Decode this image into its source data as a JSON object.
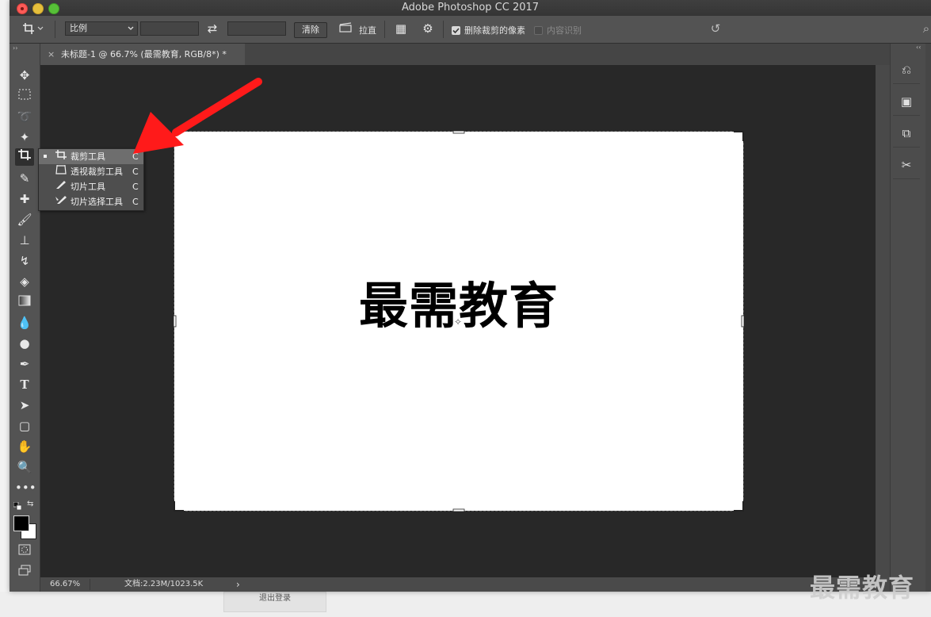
{
  "window": {
    "title": "Adobe Photoshop CC 2017"
  },
  "options_bar": {
    "tool_glyph": "⌗",
    "ratio_select": "比例",
    "width_value": "",
    "height_value": "",
    "clear_button": "清除",
    "straighten_label": "拉直",
    "delete_cropped_label": "删除裁剪的像素",
    "delete_cropped_checked": true,
    "content_aware_label": "内容识别",
    "content_aware_checked": false
  },
  "document_tab": {
    "title": "未标题-1 @ 66.7% (最需教育, RGB/8*) *",
    "close": "×"
  },
  "canvas": {
    "text": "最需教育"
  },
  "tool_flyout": {
    "items": [
      {
        "label": "裁剪工具",
        "shortcut": "C",
        "icon": "crop-icon",
        "selected": true
      },
      {
        "label": "透视裁剪工具",
        "shortcut": "C",
        "icon": "perspective-crop-icon",
        "selected": false
      },
      {
        "label": "切片工具",
        "shortcut": "C",
        "icon": "slice-icon",
        "selected": false
      },
      {
        "label": "切片选择工具",
        "shortcut": "C",
        "icon": "slice-select-icon",
        "selected": false
      }
    ]
  },
  "status_bar": {
    "zoom": "66.67%",
    "doc_size": "文档:2.23M/1023.5K",
    "arrow": "›"
  },
  "background": {
    "button_label": "退出登录"
  },
  "watermark": "最需教育",
  "colors": {
    "accent_arrow": "#ff1a1a",
    "ui_dark": "#535353",
    "canvas_bg": "#282828"
  }
}
